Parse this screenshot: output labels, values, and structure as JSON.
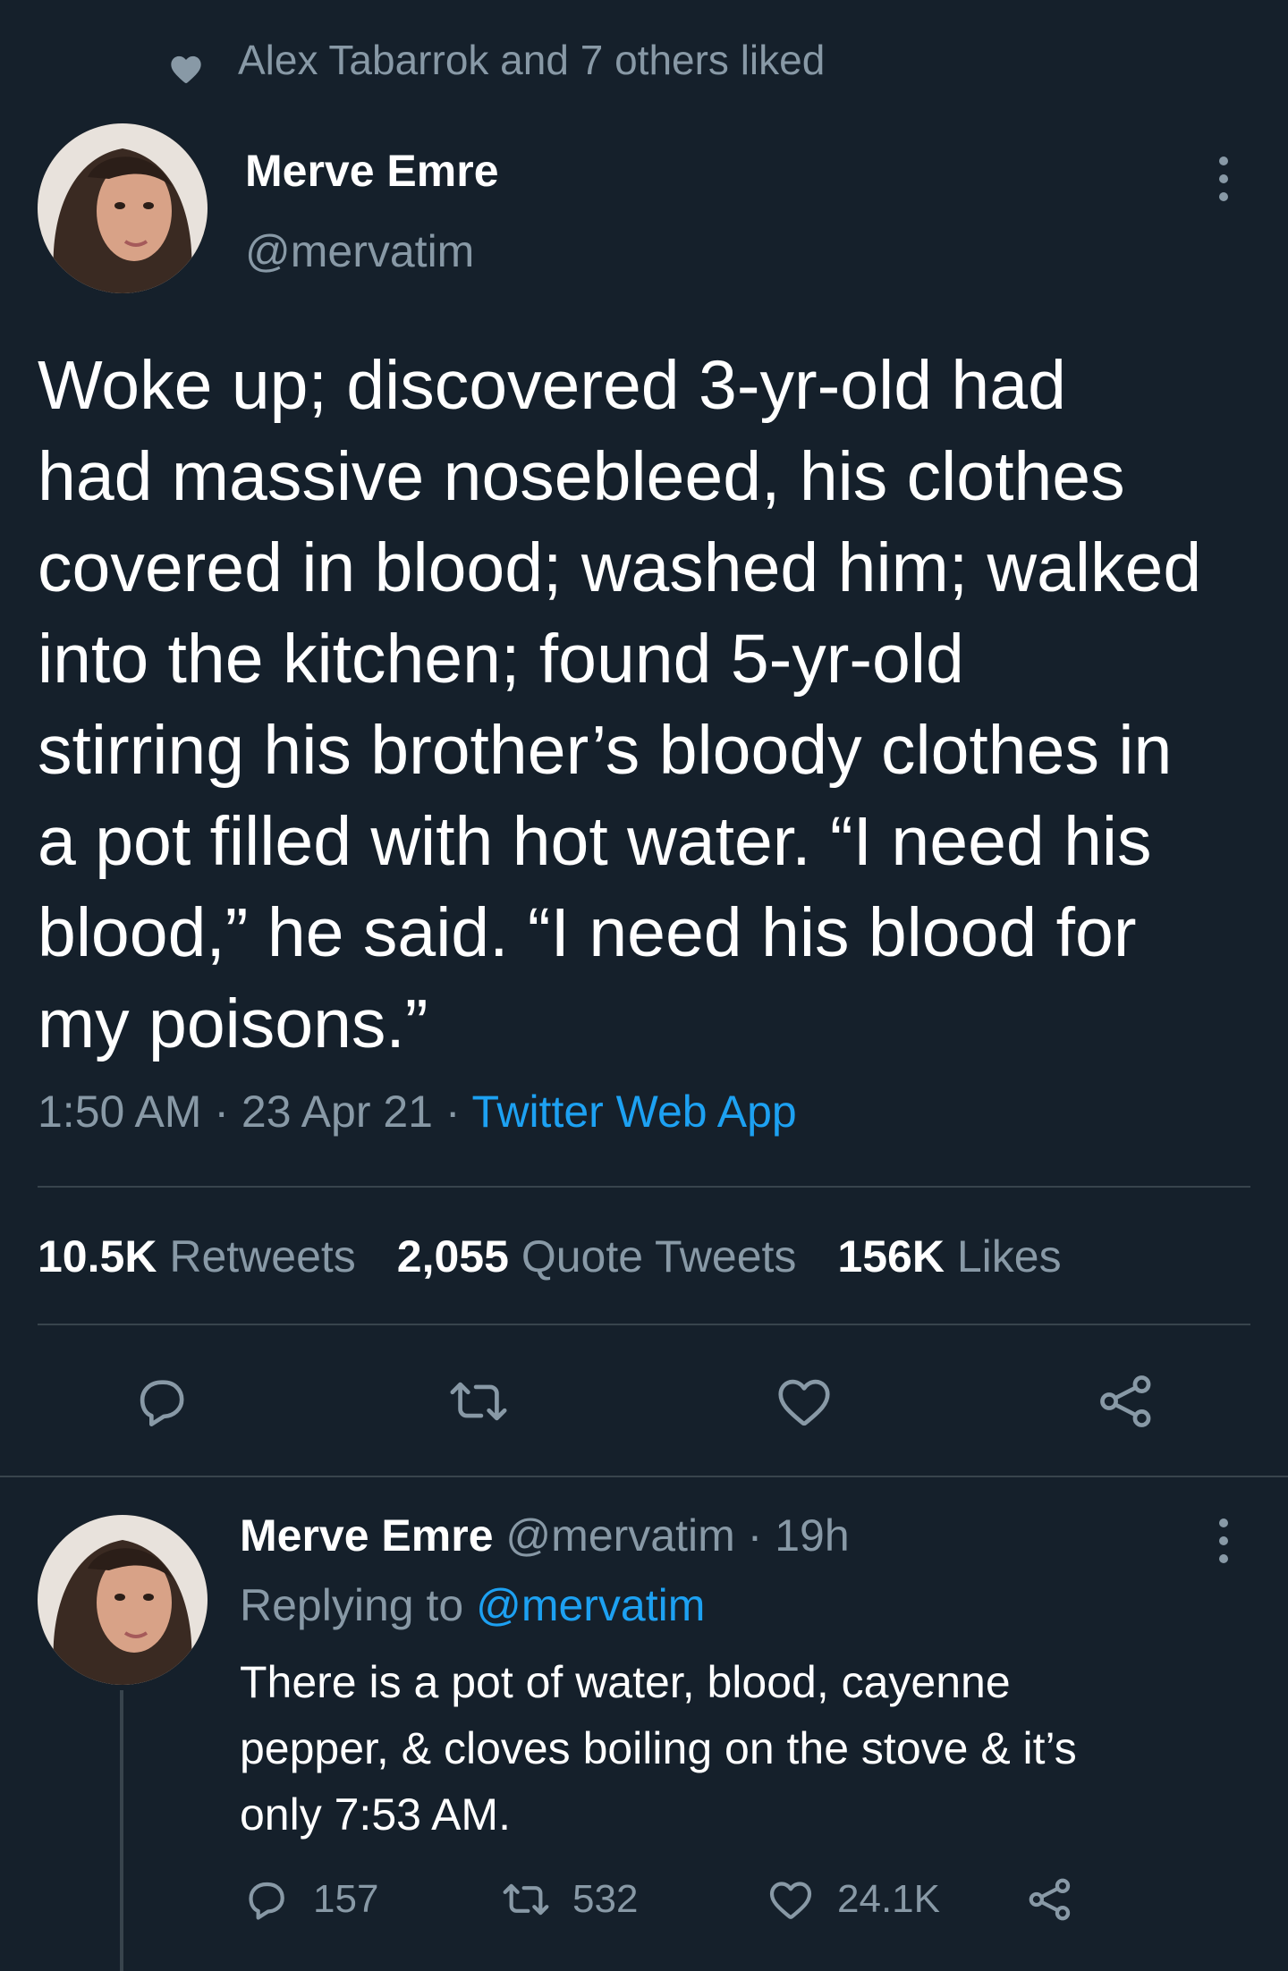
{
  "social_context": {
    "text": "Alex Tabarrok and 7 others liked",
    "icon": "heart-icon"
  },
  "main_tweet": {
    "author_name": "Merve Emre",
    "author_handle": "@mervatim",
    "text": "Woke up; discovered 3-yr-old had\nhad massive nosebleed, his clothes\ncovered in blood; washed him; walked\ninto the kitchen; found 5-yr-old\nstirring his brother’s bloody clothes in\na pot filled with hot water. “I need his\nblood,” he said. “I need his blood for\nmy poisons.”",
    "time": "1:50 AM",
    "separator": "·",
    "date": "23 Apr 21",
    "source": "Twitter Web App",
    "stats": {
      "retweets_count": "10.5K",
      "retweets_label": "Retweets",
      "quotes_count": "2,055",
      "quotes_label": "Quote Tweets",
      "likes_count": "156K",
      "likes_label": "Likes"
    },
    "actions": [
      "reply-icon",
      "retweet-icon",
      "like-icon",
      "share-icon"
    ]
  },
  "reply_tweet": {
    "author_name": "Merve Emre",
    "author_handle": "@mervatim",
    "separator": "·",
    "time_ago": "19h",
    "replying_prefix": "Replying to",
    "replying_to": "@mervatim",
    "text": "There is a pot of water, blood, cayenne\npepper, & cloves boiling on the stove & it’s\nonly 7:53 AM.",
    "reply_count": "157",
    "retweet_count": "532",
    "like_count": "24.1K"
  },
  "colors": {
    "background": "#15202b",
    "muted": "#8899a6",
    "accent": "#1da1f2",
    "divider": "#38444d"
  }
}
